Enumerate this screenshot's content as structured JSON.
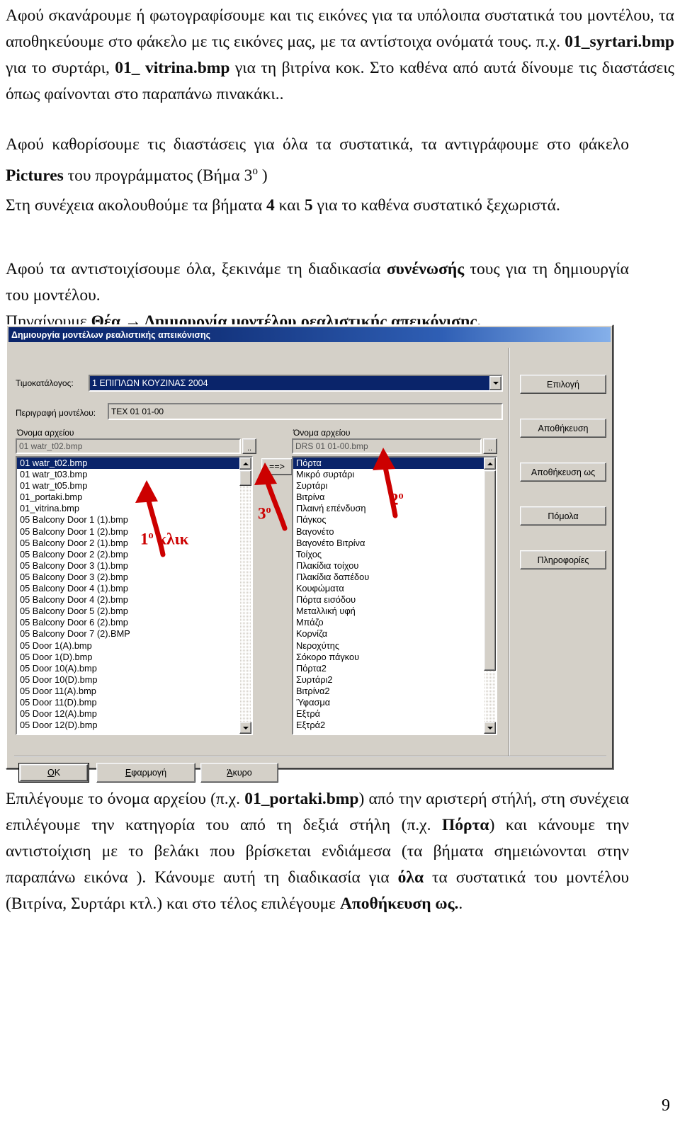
{
  "document": {
    "paragraph_top_html": "Αφού σκανάρουμε ή φωτογραφίσουμε και τις εικόνες για τα υπόλοιπα συστατικά του μοντέλου, τα αποθηκεύουμε στο φάκελο με τις εικόνες μας, με τα αντίστοιχα ονόματά τους. π.χ. <b>01_syrtari.bmp</b> για το συρτάρι, <b>01_ vitrina.bmp</b> για τη βιτρίνα κοκ. Στο καθένα από αυτά δίνουμε τις διαστάσεις όπως φαίνονται στο παραπάνω πινακάκι..",
    "paragraph_mid1_html": "Αφού καθορίσουμε τις διαστάσεις για όλα τα συστατικά, τα αντιγράφουμε στο φάκελο <b>Pictures</b> του προγράμματος (Βήμα 3<span class=\"sup\">ο</span> )",
    "paragraph_mid2_html": "Στη συνέχεια ακολουθούμε τα βήματα <b>4</b> και <b>5</b> για το καθένα συστατικό ξεχωριστά.",
    "paragraph_mid3_html": "Αφού τα αντιστοιχίσουμε όλα, ξεκινάμε τη διαδικασία <b>συνένωσής</b> τους για τη δημιουργία του μοντέλου.<br>Πηγαίνουμε <b>Θέα → Δημιουργία μοντέλου ρεαλιστικής απεικόνισης.</b>",
    "paragraph_bottom_html": "Επιλέγουμε το όνομα αρχείου (π.χ. <b>01_portaki.bmp</b>) από την αριστερή στήλή, στη συνέχεια επιλέγουμε την κατηγορία του από τη δεξιά στήλη (π.χ. <b>Πόρτα</b>) και κάνουμε την αντιστοίχιση με το βελάκι που βρίσκεται ενδιάμεσα (τα βήματα σημειώνονται στην παραπάνω εικόνα ). Κάνουμε αυτή τη διαδικασία για <b>όλα</b> τα συστατικά του μοντέλου (Βιτρίνα, Συρτάρι κτλ.) και στο τέλος επιλέγουμε <b>Αποθήκευση ως.</b>.",
    "page_number": "9"
  },
  "dialog": {
    "title": "Δημιουργία μοντέλων ρεαλιστικής απεικόνισης",
    "pricelist_label": "Τιμοκατάλογος:",
    "pricelist_value": "1 ΕΠΙΠΛΩΝ ΚΟΥΖΙΝΑΣ 2004",
    "model_desc_label": "Περιγραφή μοντέλου:",
    "model_desc_value": "TEX 01 01-00",
    "left_filename_label": "Όνομα αρχείου",
    "left_filename_value": "01 watr_t02.bmp",
    "right_filename_label": "Όνομα αρχείου",
    "right_filename_value": "DRS 01 01-00.bmp",
    "browse_label": "..",
    "assign_button_label": "==>",
    "left_list": [
      "01 watr_t02.bmp",
      "01 watr_t03.bmp",
      "01 watr_t05.bmp",
      "01_portaki.bmp",
      "01_vitrina.bmp",
      "05 Balcony Door 1 (1).bmp",
      "05 Balcony Door 1 (2).bmp",
      "05 Balcony Door 2 (1).bmp",
      "05 Balcony Door 2 (2).bmp",
      "05 Balcony Door 3 (1).bmp",
      "05 Balcony Door 3 (2).bmp",
      "05 Balcony Door 4 (1).bmp",
      "05 Balcony Door 4 (2).bmp",
      "05 Balcony Door 5 (2).bmp",
      "05 Balcony Door 6 (2).bmp",
      "05 Balcony Door 7 (2).BMP",
      "05 Door 1(A).bmp",
      "05 Door 1(D).bmp",
      "05 Door 10(A).bmp",
      "05 Door 10(D).bmp",
      "05 Door 11(A).bmp",
      "05 Door 11(D).bmp",
      "05 Door 12(A).bmp",
      "05 Door 12(D).bmp"
    ],
    "left_selected_index": 0,
    "right_list": [
      "Πόρτα",
      "Μικρό συρτάρι",
      "Συρτάρι",
      "Βιτρίνα",
      "Πλαινή επένδυση",
      "Πάγκος",
      "Βαγονέτο",
      "Βαγονέτο Βιτρίνα",
      "Τοίχος",
      "Πλακίδια τοίχου",
      "Πλακίδια δαπέδου",
      "Κουφώματα",
      "Πόρτα εισόδου",
      "Μεταλλική υφή",
      "Μπάζο",
      "Κορνίζα",
      "Νεροχύτης",
      "Σόκορο πάγκου",
      "Πόρτα2",
      "Συρτάρι2",
      "Βιτρίνα2",
      "Ύφασμα",
      "Εξτρά",
      "Εξτρά2"
    ],
    "right_selected_index": 0,
    "side_buttons": [
      "Επιλογή",
      "Αποθήκευση",
      "Αποθήκευση ως",
      "Πόμολα",
      "Πληροφορίες"
    ],
    "bottom_buttons": [
      {
        "prefix": "O",
        "rest": "K",
        "full": "OK"
      },
      {
        "prefix": "Ε",
        "rest": "φαρμογή",
        "full": "Εφαρμογή"
      },
      {
        "prefix": "Ά",
        "rest": "κυρο",
        "full": "Άκυρο"
      }
    ]
  },
  "annotations": {
    "step1": "1",
    "step1_sup": "ο",
    "step1_text": " κλικ",
    "step2": "2",
    "step2_sup": "ο",
    "step3": "3",
    "step3_sup": "ο",
    "color": "#cc0000"
  }
}
